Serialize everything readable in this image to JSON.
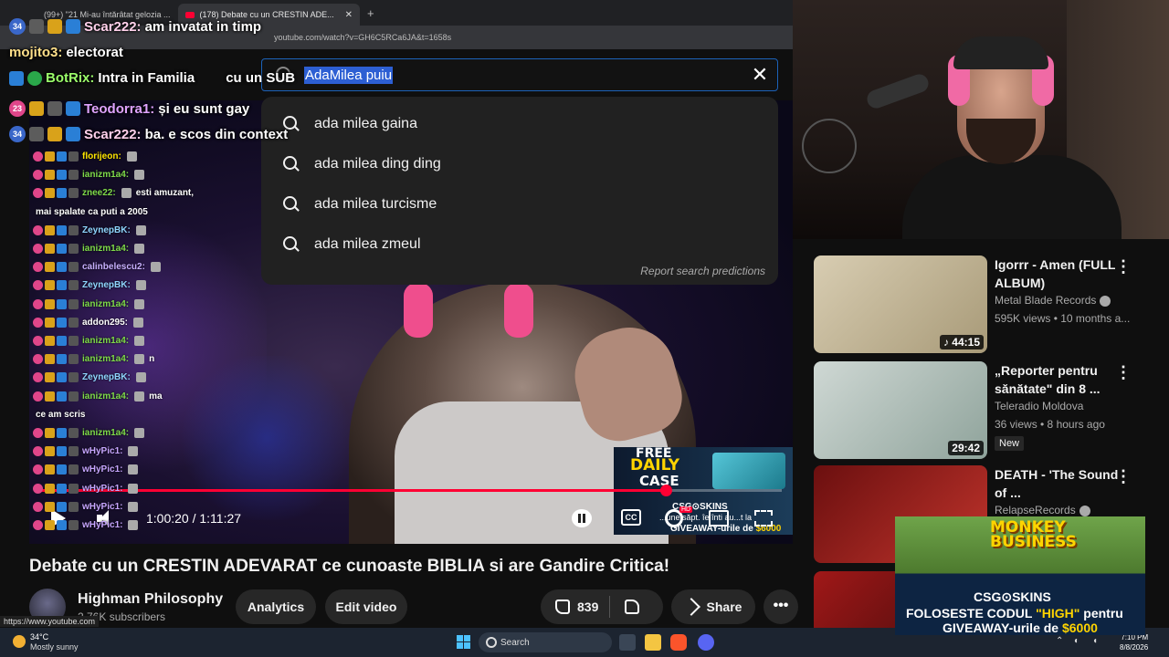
{
  "browser": {
    "tabs": [
      {
        "label": "(99+) \"21 Mi-au întărâtat gelozia ..."
      },
      {
        "label": "(178) Debate cu un CRESTIN ADE...",
        "active": true
      }
    ],
    "new_tab": "+",
    "url": "youtube.com/watch?v=GH6C5RCa6JA&t=1658s"
  },
  "search": {
    "query": "AdaMilea puiu",
    "close_label": "✕",
    "suggestions": [
      "ada milea gaina",
      "ada milea ding ding",
      "ada milea turcisme",
      "ada milea zmeul"
    ],
    "report": "Report search predictions"
  },
  "chat_overlay": [
    {
      "badge": "34",
      "user": "Scar222:",
      "msg": "am invatat in timp",
      "color": "#ffd0ea"
    },
    {
      "badge": "",
      "user": "mojito3:",
      "msg": "electorat",
      "color": "#ffe08a"
    },
    {
      "badge": "",
      "user": "BotRix:",
      "msg": "Intra in Familia",
      "color": "#9bff6a"
    },
    {
      "badge": "23",
      "user": "Teodorra1:",
      "msg": "și eu sunt gay",
      "color": "#e0a4ff"
    },
    {
      "badge": "34",
      "user": "Scar222:",
      "msg": "ba. e scos din context",
      "color": "#ffd0ea"
    }
  ],
  "chat_overlay_extra": "cu un SUB",
  "small_chat": [
    {
      "user": "florijeon:",
      "msg": "",
      "color": "#ffe600"
    },
    {
      "user": "ianizm1a4:",
      "msg": "",
      "color": "#7fdb4a"
    },
    {
      "user": "znee22:",
      "msg": "esti amuzant,",
      "color": "#7fdb4a"
    },
    {
      "user": "",
      "msg": "mai spalate ca puti a 2005",
      "color": "#fff"
    },
    {
      "user": "ZeynepBK:",
      "msg": "",
      "color": "#8fd6ff"
    },
    {
      "user": "ianizm1a4:",
      "msg": "",
      "color": "#7fdb4a"
    },
    {
      "user": "calinbelescu2:",
      "msg": "",
      "color": "#c8b0ff"
    },
    {
      "user": "ZeynepBK:",
      "msg": "",
      "color": "#8fd6ff"
    },
    {
      "user": "ianizm1a4:",
      "msg": "",
      "color": "#7fdb4a"
    },
    {
      "user": "addon295:",
      "msg": "",
      "color": "#ffffff"
    },
    {
      "user": "ianizm1a4:",
      "msg": "",
      "color": "#7fdb4a"
    },
    {
      "user": "ianizm1a4:",
      "msg": "n",
      "color": "#7fdb4a"
    },
    {
      "user": "ZeynepBK:",
      "msg": "",
      "color": "#8fd6ff"
    },
    {
      "user": "ianizm1a4:",
      "msg": "ma",
      "color": "#7fdb4a"
    },
    {
      "user": "",
      "msg": "ce am scris",
      "color": "#fff"
    },
    {
      "user": "ianizm1a4:",
      "msg": "",
      "color": "#7fdb4a"
    },
    {
      "user": "wHyPic1:",
      "msg": "",
      "color": "#c7a6ff"
    },
    {
      "user": "wHyPic1:",
      "msg": "",
      "color": "#c7a6ff"
    },
    {
      "user": "wHyPic1:",
      "msg": "",
      "color": "#c7a6ff"
    },
    {
      "user": "wHyPic1:",
      "msg": "",
      "color": "#c7a6ff"
    },
    {
      "user": "wHyPic1:",
      "msg": "",
      "color": "#c7a6ff"
    }
  ],
  "player": {
    "time": "1:00:20 / 1:11:27",
    "progress": 0.844,
    "cc": "CC",
    "hd": "HD"
  },
  "promo": {
    "line1": "FREE",
    "line2": "DAILY",
    "line3": "CASE",
    "brand": "CSG⊙SKINS",
    "line4": "...une săpt. îe înti au...t la",
    "line5a": "GIVEAWAY-urile de ",
    "line5b": "$6000"
  },
  "video": {
    "title": "Debate cu un CRESTIN ADEVARAT ce cunoaste BIBLIA si are Gandire Critica!",
    "channel": "Highman Philosophy",
    "subscribers": "2.76K subscribers",
    "analytics": "Analytics",
    "edit": "Edit video",
    "likes": "839",
    "share": "Share",
    "more": "•••"
  },
  "recommendations": [
    {
      "title": "Igorrr - Amen (FULL ALBUM)",
      "channel": "Metal Blade Records",
      "meta": "595K views • 10 months a...",
      "duration": "♪ 44:15",
      "verified": true
    },
    {
      "title": "„Reporter pentru sănătate\" din 8 ...",
      "channel": "Teleradio Moldova",
      "meta": "36 views • 8 hours ago",
      "duration": "29:42",
      "badge": "New"
    },
    {
      "title": "DEATH - 'The Sound of ...",
      "channel": "RelapseRecords",
      "meta": "",
      "duration": "",
      "verified": true
    }
  ],
  "ad": {
    "logo": "MONKEY BUSINESS",
    "brand": "CSG⊙SKINS",
    "line1a": "FOLOSESTE CODUL ",
    "line1b": "\"HIGH\"",
    "line1c": " pentru",
    "line2a": "GIVEAWAY-urile de ",
    "line2b": "$6000"
  },
  "statusbar_url": "https://www.youtube.com",
  "taskbar": {
    "temp": "34°C",
    "condition": "Mostly sunny",
    "search": "Search",
    "time": "7:10 PM",
    "date": "8/8/2026"
  }
}
